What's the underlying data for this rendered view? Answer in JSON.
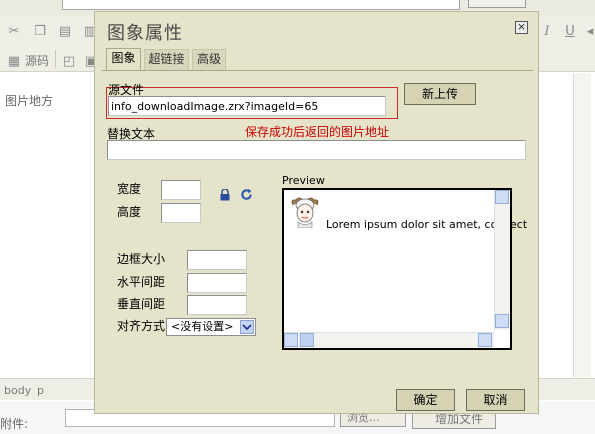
{
  "background": {
    "toolbar": {
      "source_label": "源码"
    },
    "editor_text": "图片地方",
    "status": {
      "body_tag": "body",
      "p_tag": "p"
    },
    "attach": {
      "label": "附件:",
      "browse_label": "浏览...",
      "add_label": "增加文件"
    }
  },
  "dialog": {
    "title": "图象属性",
    "tabs": [
      {
        "label": "图象",
        "active": true
      },
      {
        "label": "超链接",
        "active": false
      },
      {
        "label": "高级",
        "active": false
      }
    ],
    "source_label": "源文件",
    "source_value": "info_downloadImage.zrx?imageId=65",
    "upload_label": "新上传",
    "alt_label": "替换文本",
    "alt_value": "",
    "annotation": "保存成功后返回的图片地址",
    "width_label": "宽度",
    "width_value": "",
    "height_label": "高度",
    "height_value": "",
    "border_label": "边框大小",
    "border_value": "",
    "hspace_label": "水平间距",
    "hspace_value": "",
    "vspace_label": "垂直间距",
    "vspace_value": "",
    "align_label": "对齐方式",
    "align_value": "<没有设置>",
    "preview_label": "Preview",
    "preview_text": "Lorem ipsum dolor sit amet, consect",
    "ok_label": "确定",
    "cancel_label": "取消"
  },
  "colors": {
    "dialog_bg": "#e5e3c9",
    "highlight_border": "#cc2a2a",
    "annotation_text": "#cc0000"
  }
}
